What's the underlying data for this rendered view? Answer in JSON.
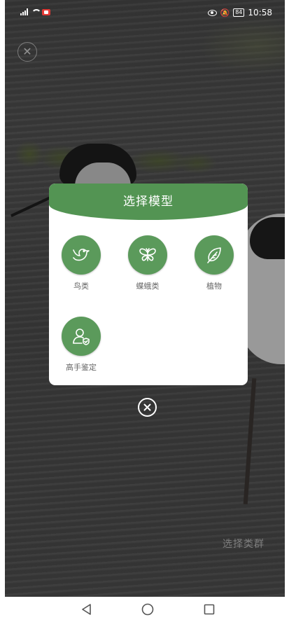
{
  "status_bar": {
    "time": "10:58",
    "battery": "84",
    "icons": [
      "signal-icon",
      "wifi-icon",
      "record-icon",
      "eye-icon",
      "mute-icon",
      "battery-icon"
    ]
  },
  "modal": {
    "title": "选择模型",
    "options": [
      {
        "label": "鸟类",
        "icon": "bird-icon"
      },
      {
        "label": "蝶蛾类",
        "icon": "butterfly-icon"
      },
      {
        "label": "植物",
        "icon": "leaf-icon"
      },
      {
        "label": "高手鉴定",
        "icon": "expert-user-icon"
      }
    ]
  },
  "background": {
    "hint": "选择类群"
  },
  "colors": {
    "accent": "#539453",
    "option_circle": "#5b9a5b",
    "label": "#666666"
  }
}
